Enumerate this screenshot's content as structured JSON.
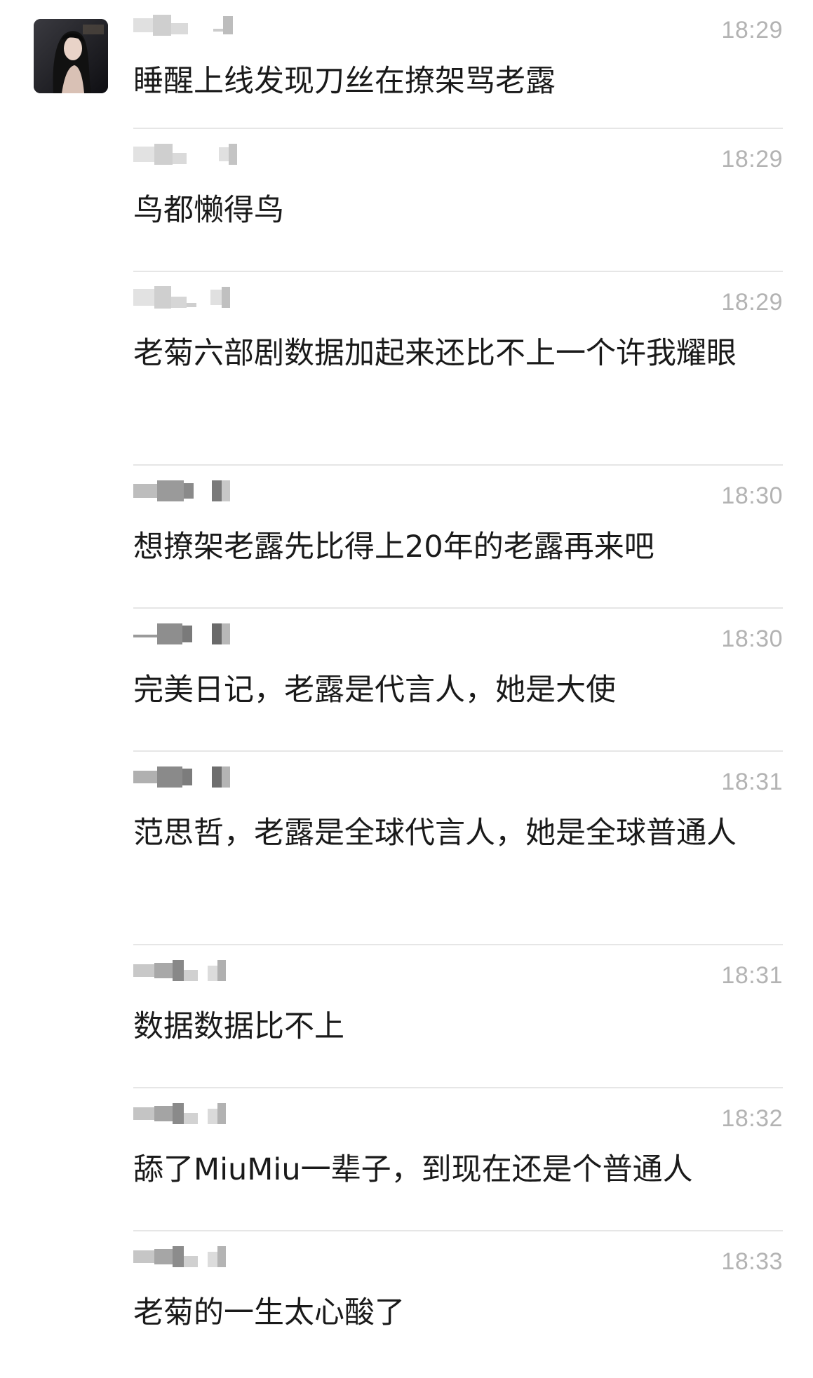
{
  "messages": [
    {
      "time": "18:29",
      "text": "睡醒上线发现刀丝在撩架骂老露"
    },
    {
      "time": "18:29",
      "text": "鸟都懒得鸟"
    },
    {
      "time": "18:29",
      "text": "老菊六部剧数据加起来还比不上一个许我耀眼"
    },
    {
      "time": "18:30",
      "text": "想撩架老露先比得上20年的老露再来吧"
    },
    {
      "time": "18:30",
      "text": "完美日记，老露是代言人，她是大使"
    },
    {
      "time": "18:31",
      "text": "范思哲，老露是全球代言人，她是全球普通人"
    },
    {
      "time": "18:31",
      "text": "数据数据比不上"
    },
    {
      "time": "18:32",
      "text": "舔了MiuMiu一辈子，到现在还是个普通人"
    },
    {
      "time": "18:33",
      "text": "老菊的一生太心酸了"
    }
  ],
  "colors": {
    "text": "#1a1a1a",
    "time": "#b3b3b3",
    "divider": "#e6e6e6",
    "background": "#ffffff"
  }
}
